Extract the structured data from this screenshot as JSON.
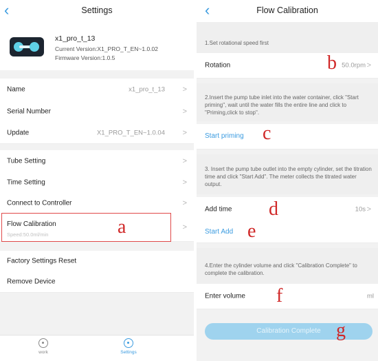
{
  "settings": {
    "title": "Settings",
    "device": {
      "name": "x1_pro_t_13",
      "current_version": "Current Version:X1_PRO_T_EN~1.0.02",
      "firmware_version": "Firmware Version:1.0.5"
    },
    "name_label": "Name",
    "name_value": "x1_pro_t_13",
    "serial_label": "Serial Number",
    "update_label": "Update",
    "update_value": "X1_PRO_T_EN~1.0.04",
    "tube_label": "Tube Setting",
    "time_label": "Time Setting",
    "connect_label": "Connect to Controller",
    "flow_label": "Flow Calibration",
    "flow_sub": "Speed:50.0ml/min",
    "factory_label": "Factory Settings Reset",
    "remove_label": "Remove Device",
    "tabs": {
      "work": "work",
      "settings": "Settings"
    }
  },
  "flow": {
    "title": "Flow Calibration",
    "step1": "1.Set rotational speed first",
    "rotation_label": "Rotation",
    "rotation_value": "50.0rpm",
    "step2": "2.Insert the pump tube inlet into the water container, click \"Start priming\", wait until the water fills the entire line and click to \"Priming,click to stop\".",
    "start_priming": "Start priming",
    "step3": "3. Insert the pump tube outlet into the empty cylinder, set the titration time and click \"Start Add\". The meter collects the titrated water output.",
    "add_time_label": "Add time",
    "add_time_value": "10s",
    "start_add": "Start Add",
    "step4": "4.Enter the cylinder volume and click \"Calibration Complete\" to complete the calibration.",
    "volume_label": "Enter volume",
    "volume_unit": "ml",
    "complete_button": "Calibration Complete"
  },
  "markers": {
    "a": "a",
    "b": "b",
    "c": "c",
    "d": "d",
    "e": "e",
    "f": "f",
    "g": "g"
  },
  "icons": {
    "back": "chevron-left-icon",
    "chevron": "chevron-right-icon",
    "work": "work-icon",
    "settings": "gear-icon"
  },
  "colors": {
    "accent": "#3a9be0",
    "alert": "#e04848",
    "marker": "#d02828",
    "button": "#9fd3ee"
  }
}
